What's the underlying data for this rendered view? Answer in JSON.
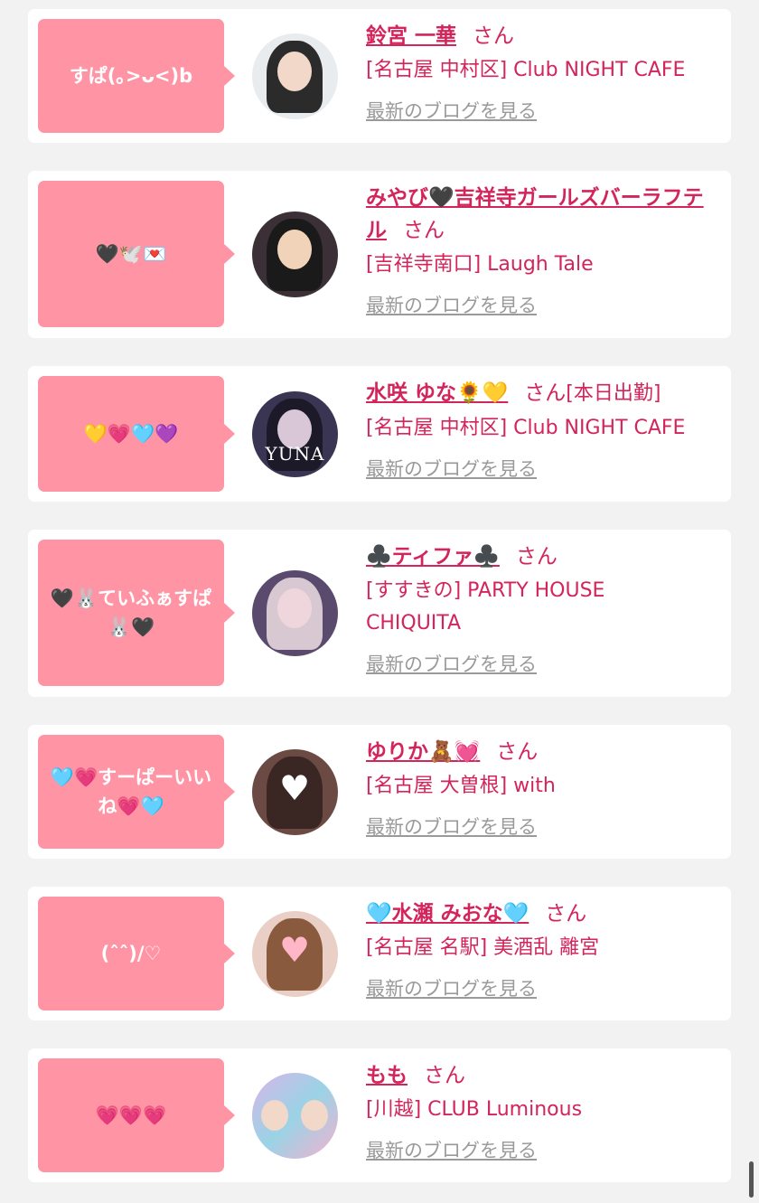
{
  "cards": [
    {
      "comment": "すぱ(｡>ᴗ<)b",
      "name": "鈴宮 一華",
      "honorific": "さん",
      "status": "",
      "shop": "[名古屋 中村区] Club NIGHT CAFE",
      "blog_label": "最新のブログを見る",
      "avatar_icon": "woman-photo-icon"
    },
    {
      "comment": "🖤🕊️💌",
      "name": "みやび🖤吉祥寺ガールズバーラフテル",
      "honorific": "さん",
      "status": "",
      "shop": "[吉祥寺南口] Laugh Tale",
      "blog_label": "最新のブログを見る",
      "avatar_icon": "woman-photo-icon"
    },
    {
      "comment": "💛💗🩵💜",
      "name": "水咲 ゆな🌻💛",
      "honorific": "さん",
      "status": "[本日出勤]",
      "shop": "[名古屋 中村区] Club NIGHT CAFE",
      "blog_label": "最新のブログを見る",
      "avatar_icon": "woman-photo-icon",
      "avatar_text": "YUNA"
    },
    {
      "comment": "🖤🐰ていふぁすぱ🐰🖤",
      "name": "♣️ティファ♣️",
      "honorific": "さん",
      "status": "",
      "shop": "[すすきの] PARTY HOUSE CHIQUITA",
      "blog_label": "最新のブログを見る",
      "avatar_icon": "woman-photo-icon"
    },
    {
      "comment": "🩵💗すーぱーいいね💗🩵",
      "name": "ゆりか🧸💓",
      "honorific": "さん",
      "status": "",
      "shop": "[名古屋 大曽根] with",
      "blog_label": "最新のブログを見る",
      "avatar_icon": "woman-photo-icon"
    },
    {
      "comment": "(ˆˆ)/♡",
      "name": "🩵水瀬 みおな🩵",
      "honorific": "さん",
      "status": "",
      "shop": "[名古屋 名駅] 美酒乱 離宮",
      "blog_label": "最新のブログを見る",
      "avatar_icon": "woman-photo-icon"
    },
    {
      "comment": "💗💗💗",
      "name": "もも",
      "honorific": "さん",
      "status": "",
      "shop": "[川越] CLUB Luminous",
      "blog_label": "最新のブログを見る",
      "avatar_icon": "collage-photo-icon"
    }
  ],
  "colors": {
    "accent": "#d3245b",
    "bubble": "#ff94a5",
    "background": "#f2f2f3"
  }
}
